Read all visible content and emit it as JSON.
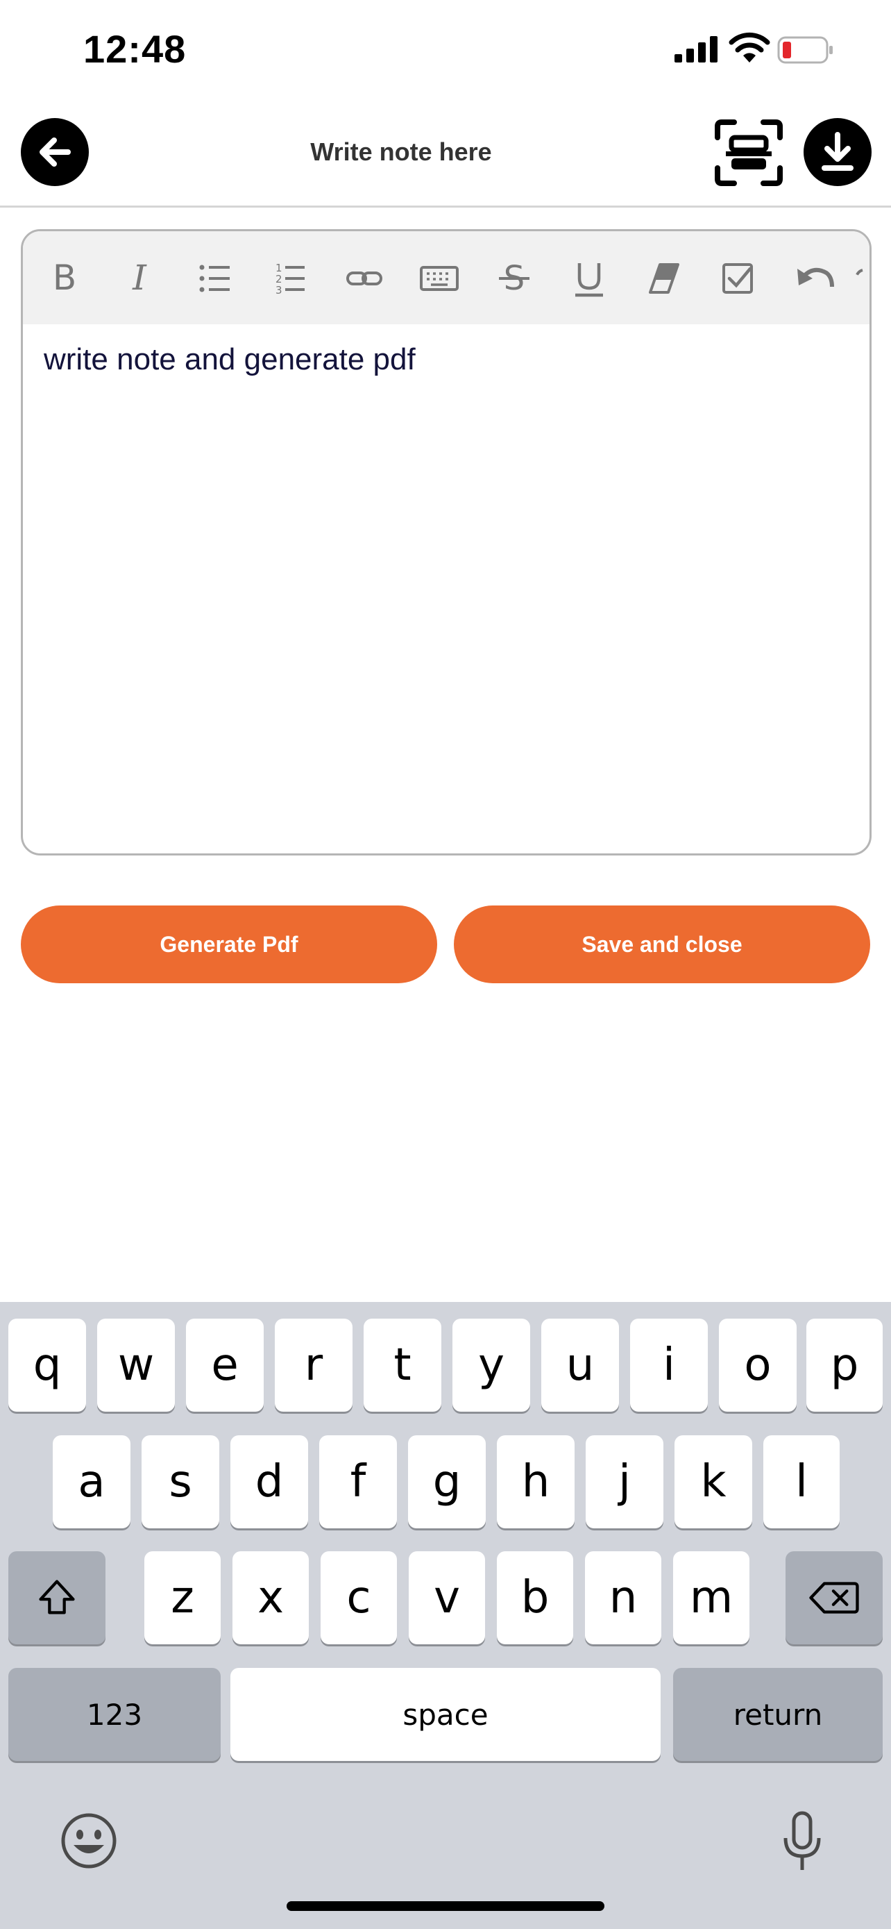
{
  "status_bar": {
    "time": "12:48"
  },
  "header": {
    "title": "Write note here"
  },
  "editor": {
    "content": "write note and generate pdf",
    "toolbar_icons": [
      "bold-icon",
      "italic-icon",
      "bullet-list-icon",
      "numbered-list-icon",
      "link-icon",
      "keyboard-icon",
      "strikethrough-icon",
      "underline-icon",
      "eraser-icon",
      "checkbox-icon",
      "undo-icon"
    ]
  },
  "buttons": {
    "generate_pdf": "Generate Pdf",
    "save_and_close": "Save and close"
  },
  "keyboard": {
    "row1": [
      "q",
      "w",
      "e",
      "r",
      "t",
      "y",
      "u",
      "i",
      "o",
      "p"
    ],
    "row2": [
      "a",
      "s",
      "d",
      "f",
      "g",
      "h",
      "j",
      "k",
      "l"
    ],
    "row3": [
      "z",
      "x",
      "c",
      "v",
      "b",
      "n",
      "m"
    ],
    "numbers_label": "123",
    "space_label": "space",
    "return_label": "return"
  },
  "colors": {
    "accent": "#ed6b30",
    "battery_low": "#e3262b"
  }
}
